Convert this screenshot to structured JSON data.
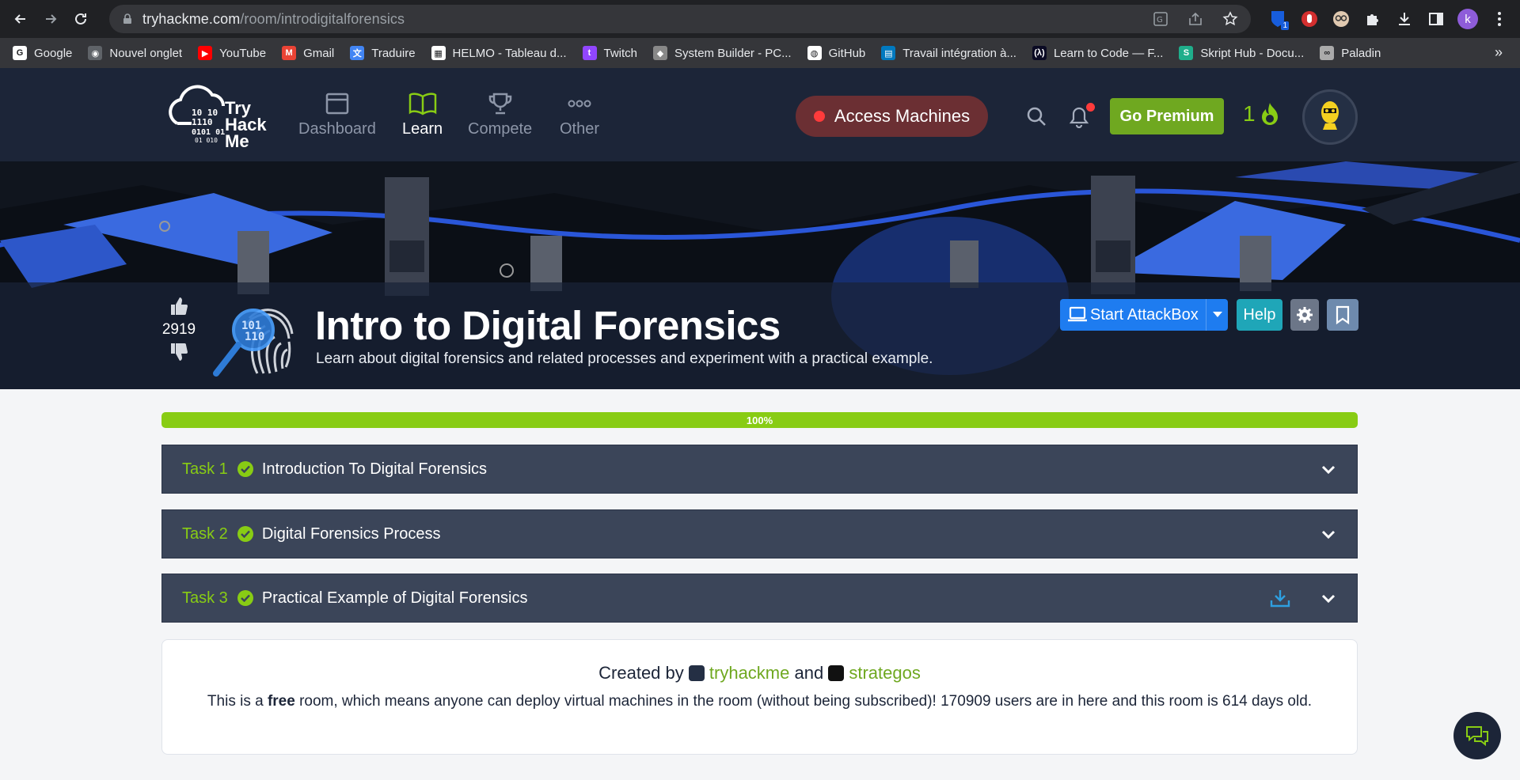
{
  "browser": {
    "url_host": "tryhackme.com",
    "url_path": "/room/introdigitalforensics",
    "profile_initial": "k",
    "extension_badge": "1",
    "bookmarks": [
      {
        "label": "Google",
        "color": "#ffffff",
        "glyph": "G"
      },
      {
        "label": "Nouvel onglet",
        "color": "#5f6368",
        "glyph": "◉"
      },
      {
        "label": "YouTube",
        "color": "#ff0000",
        "glyph": "▶"
      },
      {
        "label": "Gmail",
        "color": "#ea4335",
        "glyph": "M"
      },
      {
        "label": "Traduire",
        "color": "#4285f4",
        "glyph": "文"
      },
      {
        "label": "HELMO - Tableau d...",
        "color": "#ffffff",
        "glyph": "▦"
      },
      {
        "label": "Twitch",
        "color": "#9146ff",
        "glyph": "t"
      },
      {
        "label": "System Builder - PC...",
        "color": "#888888",
        "glyph": "◆"
      },
      {
        "label": "GitHub",
        "color": "#ffffff",
        "glyph": "◍"
      },
      {
        "label": "Travail intégration à...",
        "color": "#0079bf",
        "glyph": "▤"
      },
      {
        "label": "Learn to Code — F...",
        "color": "#0a0a23",
        "glyph": "(λ)"
      },
      {
        "label": "Skript Hub - Docu...",
        "color": "#1fae8b",
        "glyph": "S"
      },
      {
        "label": "Paladin",
        "color": "#aaaaaa",
        "glyph": "∞"
      }
    ],
    "more_label": "»"
  },
  "header": {
    "logo_lines": [
      "Try",
      "Hack",
      "Me"
    ],
    "nav": [
      {
        "label": "Dashboard",
        "icon": "dashboard-icon"
      },
      {
        "label": "Learn",
        "icon": "book-icon"
      },
      {
        "label": "Compete",
        "icon": "trophy-icon"
      },
      {
        "label": "Other",
        "icon": "more-icon"
      }
    ],
    "access_machines": "Access Machines",
    "go_premium": "Go Premium",
    "streak": "1",
    "accent": "#88cc14",
    "header_bg": "#1c2538"
  },
  "room": {
    "votes": "2919",
    "title": "Intro to Digital Forensics",
    "subtitle": "Learn about digital forensics and related processes and experiment with a practical example.",
    "start_attackbox": "Start AttackBox",
    "help": "Help",
    "progress_label": "100%",
    "progress_value": 1.0
  },
  "tasks": [
    {
      "num": "Task 1",
      "title": "Introduction To Digital Forensics",
      "completed": true,
      "has_download": false
    },
    {
      "num": "Task 2",
      "title": "Digital Forensics Process",
      "completed": true,
      "has_download": false
    },
    {
      "num": "Task 3",
      "title": "Practical Example of Digital Forensics",
      "completed": true,
      "has_download": true
    }
  ],
  "footer": {
    "created_by": "Created by",
    "author1": "tryhackme",
    "and": "and",
    "author2": "strategos",
    "desc_pre": "This is a ",
    "desc_bold": "free",
    "desc_post": " room, which means anyone can deploy virtual machines in the room (without being subscribed)! 170909 users are in here and this room is 614 days old."
  }
}
